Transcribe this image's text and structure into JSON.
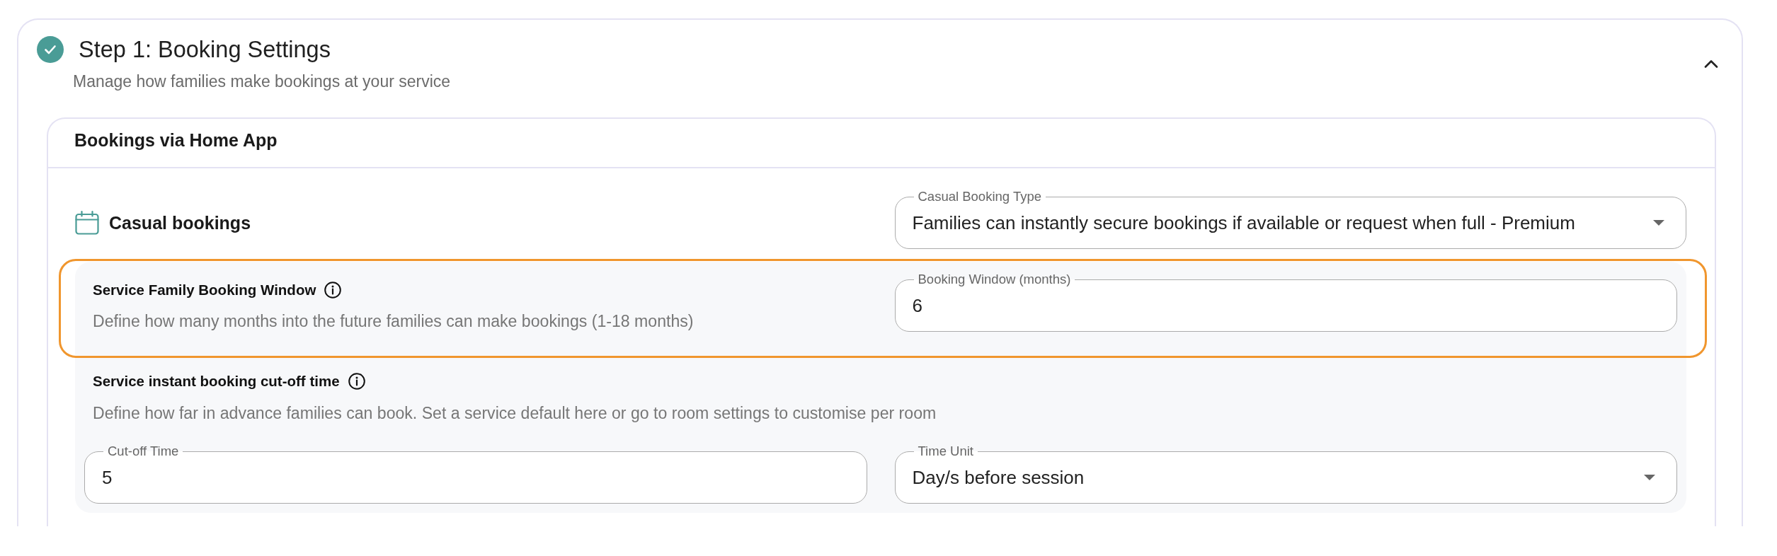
{
  "step": {
    "title": "Step 1: Booking Settings",
    "subtitle": "Manage how families make bookings at your service",
    "completed": true,
    "expanded": true
  },
  "section": {
    "title": "Bookings via Home App",
    "casual": {
      "label": "Casual bookings",
      "field": {
        "kind": "select",
        "label": "Casual Booking Type",
        "value": "Families can instantly secure bookings if available or request when full - Premium"
      }
    },
    "settings": [
      {
        "title": "Service Family Booking Window",
        "description": "Define how many months into the future families can make bookings (1-18 months)",
        "highlighted": true,
        "fields": [
          {
            "kind": "input",
            "label": "Booking Window (months)",
            "value": "6"
          }
        ]
      },
      {
        "title": "Service instant booking cut-off time",
        "description": "Define how far in advance families can book. Set a service default here or go to room settings to customise per room",
        "highlighted": false,
        "fields": [
          {
            "kind": "input",
            "label": "Cut-off Time",
            "value": "5"
          },
          {
            "kind": "select",
            "label": "Time Unit",
            "value": "Day/s before session"
          }
        ]
      }
    ]
  }
}
